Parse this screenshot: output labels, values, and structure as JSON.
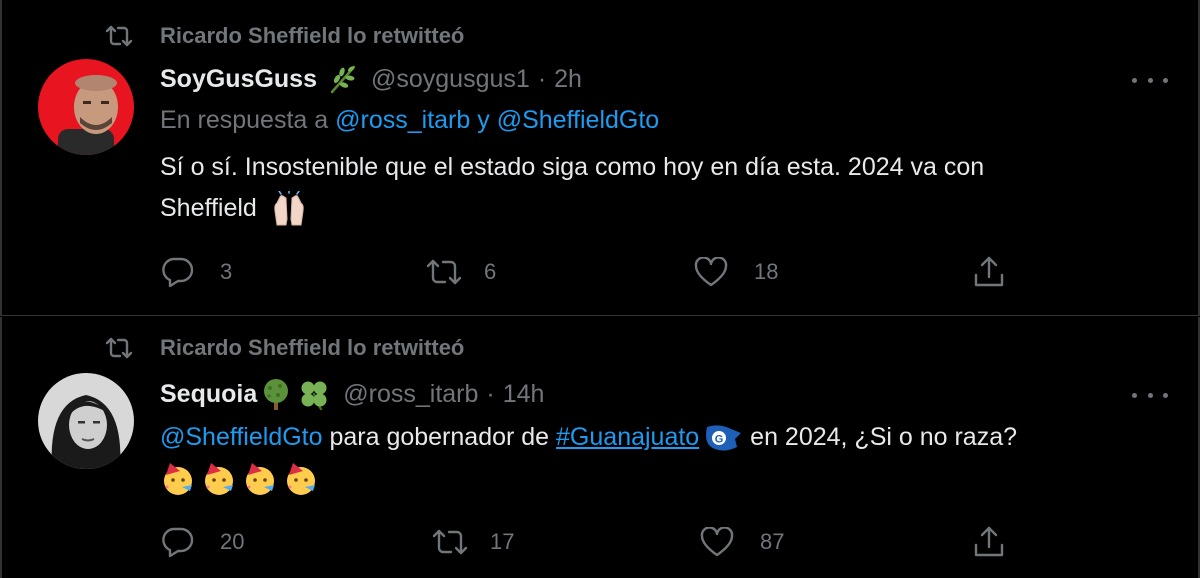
{
  "colors": {
    "background": "#000000",
    "text": "#e7e9ea",
    "secondary": "#71767b",
    "link": "#1d9bf0",
    "border": "#2f3336"
  },
  "tweets": [
    {
      "retweeted_by": "Ricardo Sheffield lo retwitteó",
      "display_name": "SoyGusGuss",
      "name_emoji": "herb",
      "handle": "@soygusgus1",
      "separator": "·",
      "time": "2h",
      "reply_prefix": "En respuesta a",
      "reply_user_1": "@ross_itarb",
      "reply_and": "y",
      "reply_user_2": "@SheffieldGto",
      "text_line_1": "Sí o sí. Insostenible que el estado siga como hoy en día esta. 2024 va con",
      "text_line_2": "Sheffield",
      "text_emoji": "raising-hands-emoji",
      "replies": "3",
      "retweets": "6",
      "likes": "18"
    },
    {
      "retweeted_by": "Ricardo Sheffield lo retwitteó",
      "display_name": "Sequoia",
      "name_emoji": "deciduous-tree, four-leaf-clover",
      "handle": "@ross_itarb",
      "separator": "·",
      "time": "14h",
      "mention": "@SheffieldGto",
      "text_mid": " para gobernador de ",
      "hashtag": "#Guanajuato",
      "text_end": " en 2024, ¿Si o no raza?",
      "text_emoji": "partying-face-emoji x4",
      "replies": "20",
      "retweets": "17",
      "likes": "87"
    }
  ]
}
